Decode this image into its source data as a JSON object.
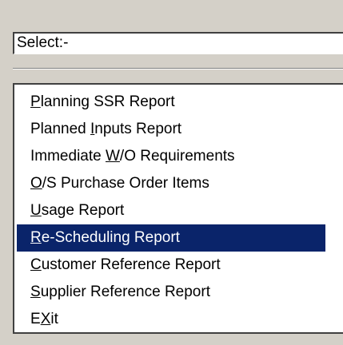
{
  "select": {
    "label": "Select:-"
  },
  "menu": {
    "items": [
      {
        "pre": "",
        "key": "P",
        "post": "lanning SSR Report",
        "selected": false
      },
      {
        "pre": "Planned ",
        "key": "I",
        "post": "nputs Report",
        "selected": false
      },
      {
        "pre": "Immediate ",
        "key": "W",
        "post": "/O Requirements",
        "selected": false
      },
      {
        "pre": "",
        "key": "O",
        "post": "/S Purchase Order Items",
        "selected": false
      },
      {
        "pre": "",
        "key": "U",
        "post": "sage Report",
        "selected": false
      },
      {
        "pre": "",
        "key": "R",
        "post": "e-Scheduling Report",
        "selected": true
      },
      {
        "pre": "",
        "key": "C",
        "post": "ustomer Reference Report",
        "selected": false
      },
      {
        "pre": "",
        "key": "S",
        "post": "upplier Reference Report",
        "selected": false
      },
      {
        "pre": "E",
        "key": "X",
        "post": "it",
        "selected": false
      }
    ]
  },
  "colors": {
    "window_bg": "#d4d0c8",
    "selection_bg": "#0a246a",
    "selection_text": "#ffffff"
  }
}
